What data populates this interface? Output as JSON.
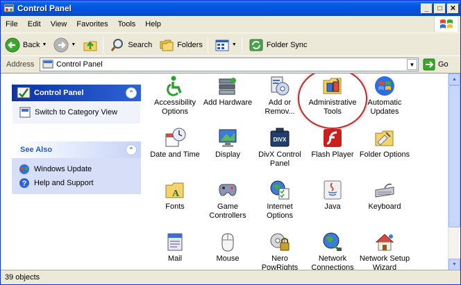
{
  "window": {
    "title": "Control Panel"
  },
  "menu": [
    "File",
    "Edit",
    "View",
    "Favorites",
    "Tools",
    "Help"
  ],
  "toolbar": {
    "back": "Back",
    "search": "Search",
    "folders": "Folders",
    "folder_sync": "Folder Sync"
  },
  "address": {
    "label": "Address",
    "value": "Control Panel",
    "go": "Go"
  },
  "taskpane": {
    "control_panel": {
      "title": "Control Panel",
      "link": "Switch to Category View"
    },
    "see_also": {
      "title": "See Also",
      "links": [
        "Windows Update",
        "Help and Support"
      ]
    }
  },
  "items": [
    {
      "label": "Accessibility Options",
      "icon": "accessibility-icon"
    },
    {
      "label": "Add Hardware",
      "icon": "add-hardware-icon"
    },
    {
      "label": "Add or Remov...",
      "icon": "add-remove-programs-icon"
    },
    {
      "label": "Administrative Tools",
      "icon": "administrative-tools-icon"
    },
    {
      "label": "Automatic Updates",
      "icon": "automatic-updates-icon"
    },
    {
      "label": "Date and Time",
      "icon": "date-time-icon"
    },
    {
      "label": "Display",
      "icon": "display-icon"
    },
    {
      "label": "DivX Control Panel",
      "icon": "divx-icon"
    },
    {
      "label": "Flash Player",
      "icon": "flash-player-icon"
    },
    {
      "label": "Folder Options",
      "icon": "folder-options-icon"
    },
    {
      "label": "Fonts",
      "icon": "fonts-icon"
    },
    {
      "label": "Game Controllers",
      "icon": "game-controller-icon"
    },
    {
      "label": "Internet Options",
      "icon": "internet-options-icon"
    },
    {
      "label": "Java",
      "icon": "java-icon"
    },
    {
      "label": "Keyboard",
      "icon": "keyboard-icon"
    },
    {
      "label": "Mail",
      "icon": "mail-icon"
    },
    {
      "label": "Mouse",
      "icon": "mouse-icon"
    },
    {
      "label": "Nero PowRights",
      "icon": "nero-icon"
    },
    {
      "label": "Network Connections",
      "icon": "network-connections-icon"
    },
    {
      "label": "Network Setup Wizard",
      "icon": "network-setup-icon"
    }
  ],
  "status": {
    "text": "39 objects"
  },
  "colors": {
    "title_bar": "#0054E3",
    "highlight_ring": "#B73030",
    "pane_header": "#0C32A8"
  }
}
